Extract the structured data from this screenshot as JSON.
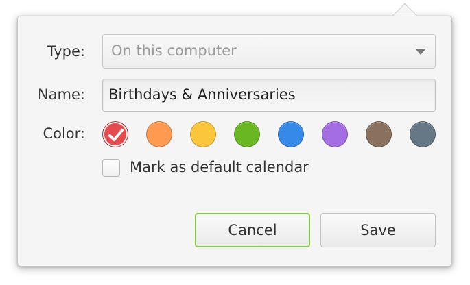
{
  "form": {
    "type_label": "Type:",
    "type_value": "On this computer",
    "name_label": "Name:",
    "name_value": "Birthdays & Anniversaries",
    "color_label": "Color:",
    "colors": [
      {
        "name": "red",
        "hex": "#e54b4e",
        "selected": true
      },
      {
        "name": "orange",
        "hex": "#ff9a50"
      },
      {
        "name": "yellow",
        "hex": "#fbc63c"
      },
      {
        "name": "green",
        "hex": "#68b723"
      },
      {
        "name": "blue",
        "hex": "#3689e6"
      },
      {
        "name": "purple",
        "hex": "#a56de2"
      },
      {
        "name": "brown",
        "hex": "#8a715e"
      },
      {
        "name": "slate",
        "hex": "#667885"
      }
    ],
    "default_checkbox_label": "Mark as default calendar",
    "default_checked": false
  },
  "actions": {
    "cancel_label": "Cancel",
    "save_label": "Save"
  },
  "style": {
    "focus_color": "#87c94b"
  }
}
